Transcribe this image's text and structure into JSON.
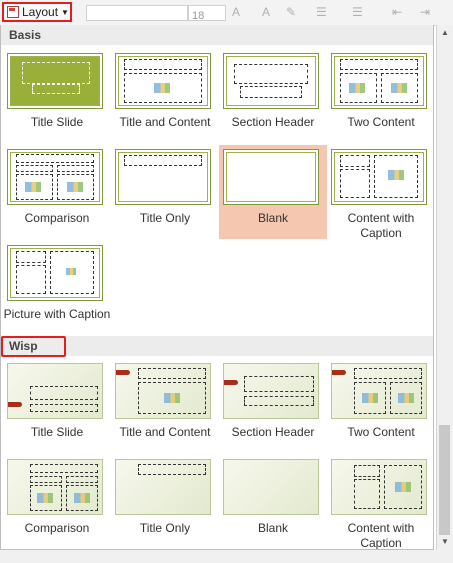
{
  "toolbar": {
    "layout_label": "Layout",
    "font_size": "18"
  },
  "sections": {
    "basis": {
      "title": "Basis"
    },
    "wisp": {
      "title": "Wisp"
    }
  },
  "basis_layouts": [
    {
      "label": "Title Slide"
    },
    {
      "label": "Title and Content"
    },
    {
      "label": "Section Header"
    },
    {
      "label": "Two Content"
    },
    {
      "label": "Comparison"
    },
    {
      "label": "Title Only"
    },
    {
      "label": "Blank"
    },
    {
      "label": "Content with Caption"
    },
    {
      "label": "Picture with Caption"
    }
  ],
  "wisp_layouts": [
    {
      "label": "Title Slide"
    },
    {
      "label": "Title and Content"
    },
    {
      "label": "Section Header"
    },
    {
      "label": "Two Content"
    },
    {
      "label": "Comparison"
    },
    {
      "label": "Title Only"
    },
    {
      "label": "Blank"
    },
    {
      "label": "Content with Caption"
    }
  ],
  "selected": "Blank",
  "colors": {
    "selection": "#f5c6b0",
    "highlight": "#e02020",
    "theme_green": "#9aaf3a",
    "wisp_accent": "#a62f1c"
  }
}
